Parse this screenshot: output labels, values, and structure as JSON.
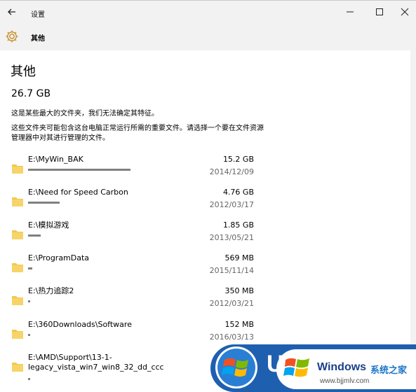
{
  "window": {
    "title": "设置",
    "header_title": "其他",
    "back_icon": "back-arrow-icon",
    "gear_icon": "gear-icon"
  },
  "page": {
    "heading": "其他",
    "total_size": "26.7 GB",
    "desc1": "这是某些最大的文件夹，我们无法确定其特征。",
    "desc2": "这些文件夹可能包含这台电脑正常运行所需的重要文件。请选择一个要在文件资源管理器中对其进行管理的文件。"
  },
  "folders": [
    {
      "path": "E:\\MyWin_BAK",
      "size": "15.2 GB",
      "date": "2014/12/09",
      "share": 1.0
    },
    {
      "path": "E:\\Need for Speed Carbon",
      "size": "4.76 GB",
      "date": "2012/03/17",
      "share": 0.31
    },
    {
      "path": "E:\\模拟游戏",
      "size": "1.85 GB",
      "date": "2013/05/21",
      "share": 0.12
    },
    {
      "path": "E:\\ProgramData",
      "size": "569 MB",
      "date": "2015/11/14",
      "share": 0.04
    },
    {
      "path": "E:\\热力追踪2",
      "size": "350 MB",
      "date": "2012/03/21",
      "share": 0.02
    },
    {
      "path": "E:\\360Downloads\\Software",
      "size": "152 MB",
      "date": "2016/03/13",
      "share": 0.01
    },
    {
      "path": "E:\\AMD\\Support\\13-1-\nlegacy_vista_win7_win8_32_dd_ccc",
      "size": "",
      "date": "",
      "share": 0.01
    }
  ],
  "watermark": {
    "u_letter": "U",
    "windows": "Windows",
    "cn": "系统之家",
    "url": "www.bjjmlv.com"
  },
  "colors": {
    "chrome": "#f2f2f2",
    "folder": "#f2c94c",
    "bar": "#808080"
  }
}
